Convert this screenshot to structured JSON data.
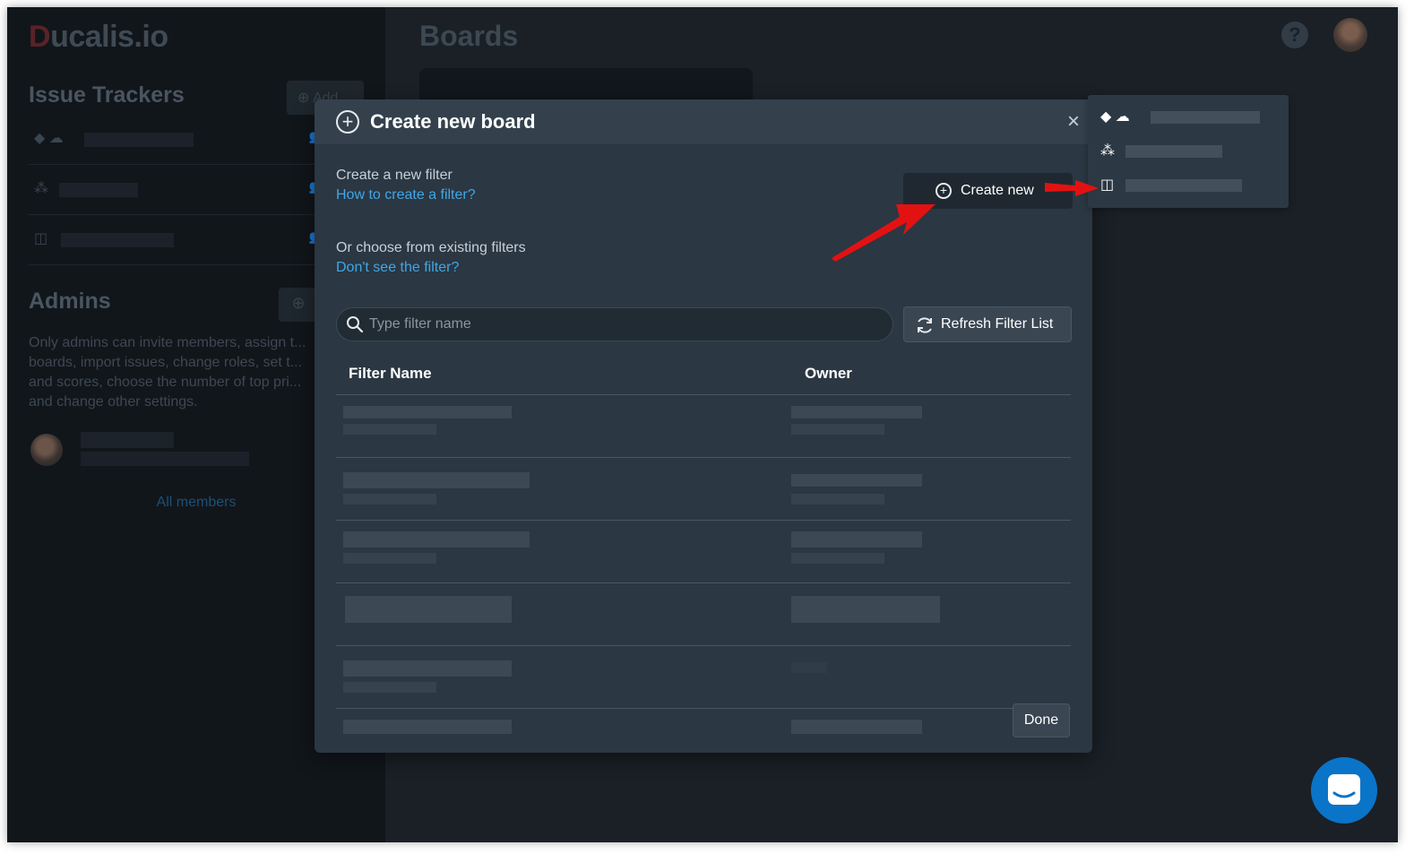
{
  "app": {
    "logo_first": "D",
    "logo_rest": "ucalis.io",
    "page_title": "Boards"
  },
  "sidebar": {
    "issue_trackers_title": "Issue Trackers",
    "add_label": "Add",
    "admins_title": "Admins",
    "admins_description": "Only admins can invite members, assign t... boards, import issues, change roles, set t... and scores, choose the number of top pri... and change other settings.",
    "all_members": "All members",
    "trackers": [
      {
        "icon": "gitlab-cloud-icons"
      },
      {
        "icon": "asana-icon"
      },
      {
        "icon": "trello-icon"
      }
    ]
  },
  "dropdown": {
    "items": [
      {
        "icon": "gitlab-cloud-icons"
      },
      {
        "icon": "asana-icon"
      },
      {
        "icon": "trello-icon"
      }
    ]
  },
  "modal": {
    "title": "Create new board",
    "close": "×",
    "create_filter_text": "Create a new filter",
    "how_to_link": "How to create a filter?",
    "create_new_button": "Create new",
    "choose_existing_text": "Or choose from existing filters",
    "dont_see_link": "Don't see the filter?",
    "search_placeholder": "Type filter name",
    "refresh_button": "Refresh Filter List",
    "columns": [
      "Filter Name",
      "Owner"
    ],
    "done_button": "Done"
  },
  "colors": {
    "accent_link": "#3fa7e8",
    "modal_bg": "#2b3742",
    "arrow": "#e31212",
    "chat_button": "#0a74c9"
  }
}
